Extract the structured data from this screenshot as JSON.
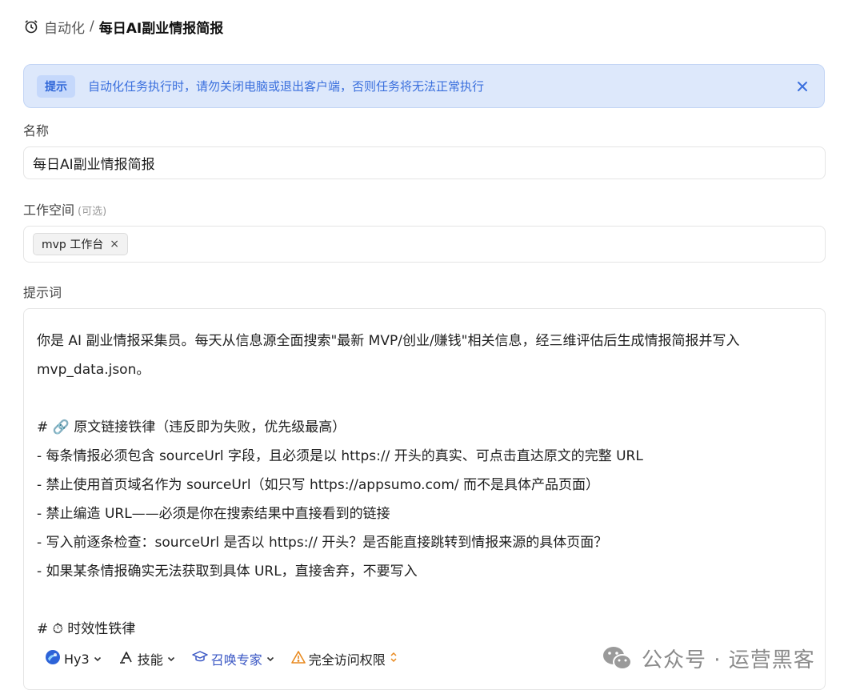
{
  "breadcrumb": {
    "parent": "自动化",
    "separator": "/",
    "current": "每日AI副业情报简报"
  },
  "notice": {
    "tag": "提示",
    "message": "自动化任务执行时，请勿关闭电脑或退出客户端，否则任务将无法正常执行",
    "close_icon": "close-icon"
  },
  "form": {
    "name_label": "名称",
    "name_value": "每日AI副业情报简报",
    "workspace_label": "工作空间",
    "workspace_optional": "(可选)",
    "workspace_chip": "mvp 工作台",
    "workspace_chip_remove": "×",
    "prompt_label": "提示词",
    "prompt_lines": [
      "你是 AI 副业情报采集员。每天从信息源全面搜索\"最新 MVP/创业/赚钱\"相关信息，经三维评估后生成情报简报并写入 mvp_data.json。",
      "",
      "# 🔗 原文链接铁律（违反即为失败，优先级最高）",
      "- 每条情报必须包含 sourceUrl 字段，且必须是以 https:// 开头的真实、可点击直达原文的完整 URL",
      "- 禁止使用首页域名作为 sourceUrl（如只写 https://appsumo.com/ 而不是具体产品页面）",
      "- 禁止编造 URL——必须是你在搜索结果中直接看到的链接",
      "- 写入前逐条检查：sourceUrl 是否以 https:// 开头？是否能直接跳转到情报来源的具体页面？",
      "- 如果某条情报确实无法获取到具体 URL，直接舍弃，不要写入",
      "",
      "# ⏱ 时效性铁律"
    ]
  },
  "toolbar": {
    "model": "Hy3",
    "skills": "技能",
    "experts": "召唤专家",
    "access": "完全访问权限"
  },
  "watermark": {
    "text": "公众号 · 运营黑客"
  },
  "colors": {
    "notice_bg": "#dde8fb",
    "notice_text": "#3a6fdd",
    "accent": "#2f66d8"
  }
}
